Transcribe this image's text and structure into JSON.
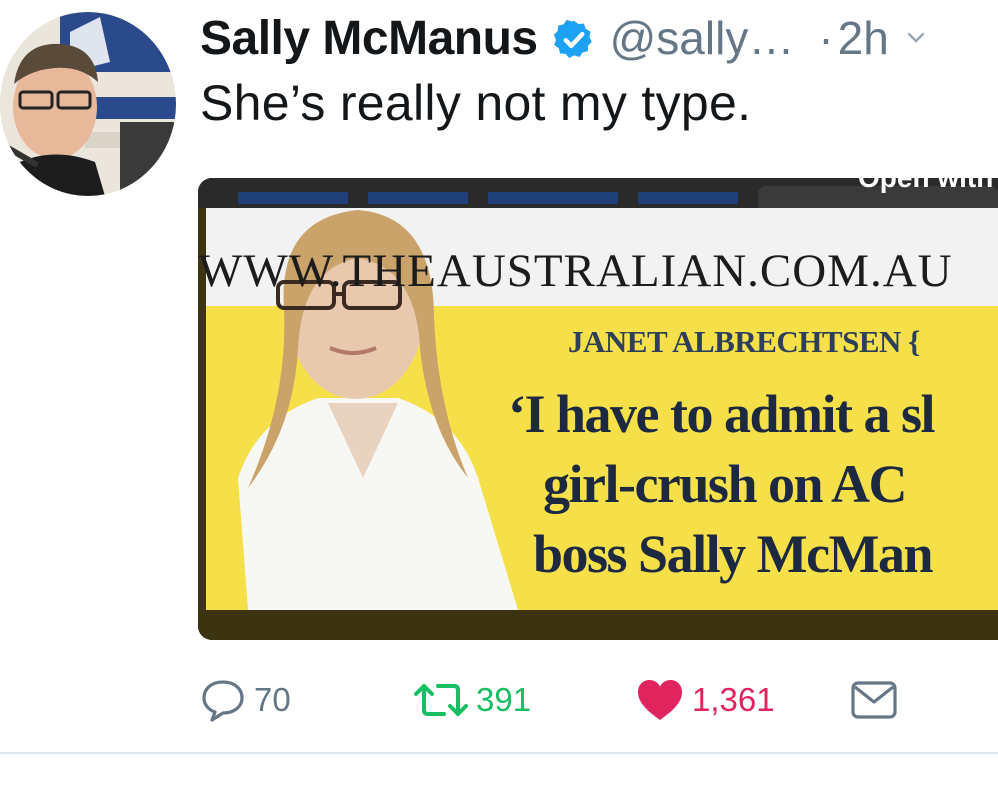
{
  "tweet": {
    "author_name": "Sally McManus",
    "handle": "@sally…",
    "separator": "·",
    "time": "2h",
    "text": "She’s really not my type."
  },
  "media": {
    "site_url": "WWW.THEAUSTRALIAN.COM.AU",
    "byline": "JANET ALBRECHTSEN {",
    "headline_lines": [
      "‘I have to admit a sl",
      "girl-crush on AC",
      "boss Sally McMan"
    ],
    "overlay_label": "Open with"
  },
  "actions": {
    "replies": "70",
    "retweets": "391",
    "likes": "1,361"
  },
  "colors": {
    "verified": "#1da1f2",
    "retweet": "#17bf63",
    "like": "#e0245e",
    "muted": "#657786",
    "banner_yellow": "#f5e04a"
  },
  "icons": [
    "verified-badge-icon",
    "chevron-down-icon",
    "reply-icon",
    "retweet-icon",
    "like-icon",
    "direct-message-icon"
  ]
}
